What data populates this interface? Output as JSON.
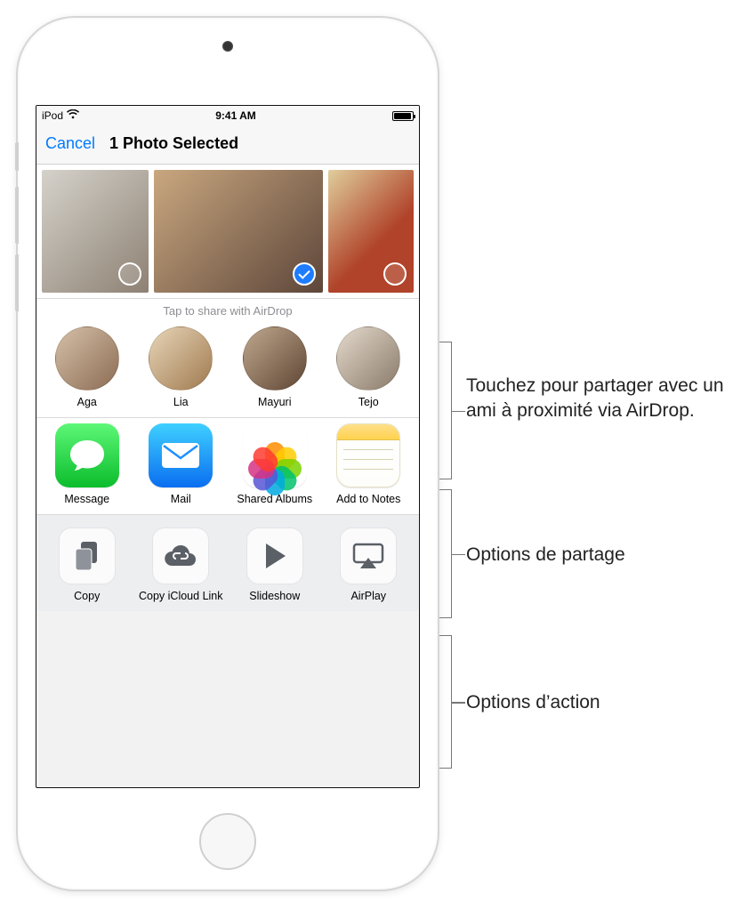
{
  "status": {
    "carrier": "iPod",
    "time": "9:41 AM"
  },
  "nav": {
    "cancel": "Cancel",
    "title": "1 Photo Selected"
  },
  "thumbs": {
    "selected_index": 1
  },
  "airdrop": {
    "caption": "Tap to share with AirDrop",
    "people": [
      {
        "name": "Aga"
      },
      {
        "name": "Lia"
      },
      {
        "name": "Mayuri"
      },
      {
        "name": "Tejo"
      }
    ]
  },
  "share_apps": [
    {
      "name": "Message",
      "icon": "messages"
    },
    {
      "name": "Mail",
      "icon": "mail"
    },
    {
      "name": "Shared Albums",
      "icon": "photos"
    },
    {
      "name": "Add to Notes",
      "icon": "notes"
    }
  ],
  "actions": [
    {
      "name": "Copy",
      "icon": "copy"
    },
    {
      "name": "Copy iCloud Link",
      "icon": "cloud-link"
    },
    {
      "name": "Slideshow",
      "icon": "play"
    },
    {
      "name": "AirPlay",
      "icon": "airplay"
    }
  ],
  "callouts": {
    "airdrop": "Touchez pour partager avec un ami à proximité via AirDrop.",
    "share": "Options de partage",
    "actions": "Options d’action"
  }
}
